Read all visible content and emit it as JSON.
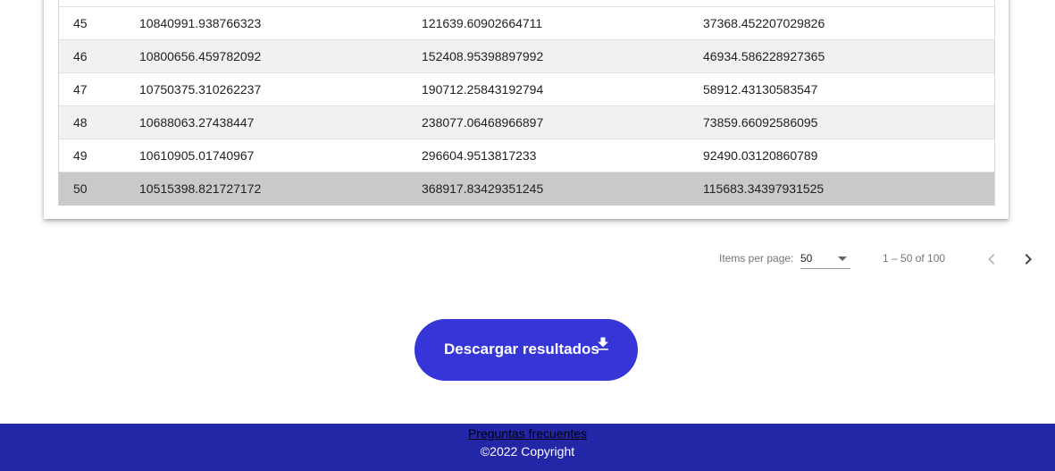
{
  "table": {
    "rows": [
      {
        "c0": "45",
        "c1": "10840991.938766323",
        "c2": "121639.60902664711",
        "c3": "37368.452207029826"
      },
      {
        "c0": "46",
        "c1": "10800656.459782092",
        "c2": "152408.95398897992",
        "c3": "46934.586228927365"
      },
      {
        "c0": "47",
        "c1": "10750375.310262237",
        "c2": "190712.25843192794",
        "c3": "58912.43130583547"
      },
      {
        "c0": "48",
        "c1": "10688063.27438447",
        "c2": "238077.06468966897",
        "c3": "73859.66092586095"
      },
      {
        "c0": "49",
        "c1": "10610905.01740967",
        "c2": "296604.9513817233",
        "c3": "92490.03120860789"
      },
      {
        "c0": "50",
        "c1": "10515398.821727172",
        "c2": "368917.83429351245",
        "c3": "115683.34397931525"
      }
    ]
  },
  "paginator": {
    "items_per_page_label": "Items per page:",
    "page_size": "50",
    "range_label": "1 – 50 of 100",
    "prev_icon": "chevron-left-icon",
    "next_icon": "chevron-right-icon"
  },
  "download": {
    "label": "Descargar resultados",
    "icon": "download-icon"
  },
  "footer": {
    "faq_link": "Preguntas frecuentes",
    "copyright": "©2022 Copyright"
  },
  "colors": {
    "accent": "#3535d8",
    "footer_bg": "#2426a8",
    "row_alt": "#f1f1f1",
    "row_selected": "#c9c9c9"
  }
}
